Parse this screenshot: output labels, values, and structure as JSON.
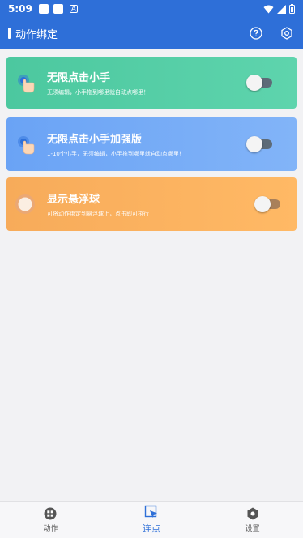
{
  "status_bar": {
    "time": "5:09",
    "notif_letter": "A"
  },
  "app_bar": {
    "title": "动作绑定",
    "help_icon": "help-circle-icon",
    "settings_icon": "hex-settings-icon"
  },
  "cards": [
    {
      "title": "无限点击小手",
      "description": "无须编辑，小手拖到哪里就自动点哪里！",
      "toggle_on": false,
      "color": "#4cc89f"
    },
    {
      "title": "无限点击小手加强版",
      "description": "1-10个小手，无须编辑，小手拖到哪里就自动点哪里！",
      "toggle_on": false,
      "color": "#6aa3f5"
    },
    {
      "title": "显示悬浮球",
      "description": "可将动作绑定到悬浮球上，点击即可执行",
      "toggle_on": false,
      "color": "#f7ab5a"
    }
  ],
  "bottom_nav": [
    {
      "label": "动作",
      "icon": "grid-app-icon",
      "active": false
    },
    {
      "label": "连点",
      "icon": "cursor-click-icon",
      "active": true
    },
    {
      "label": "设置",
      "icon": "hex-gear-icon",
      "active": false
    }
  ],
  "colors": {
    "primary": "#2e6fd8",
    "background": "#f2f2f4"
  }
}
